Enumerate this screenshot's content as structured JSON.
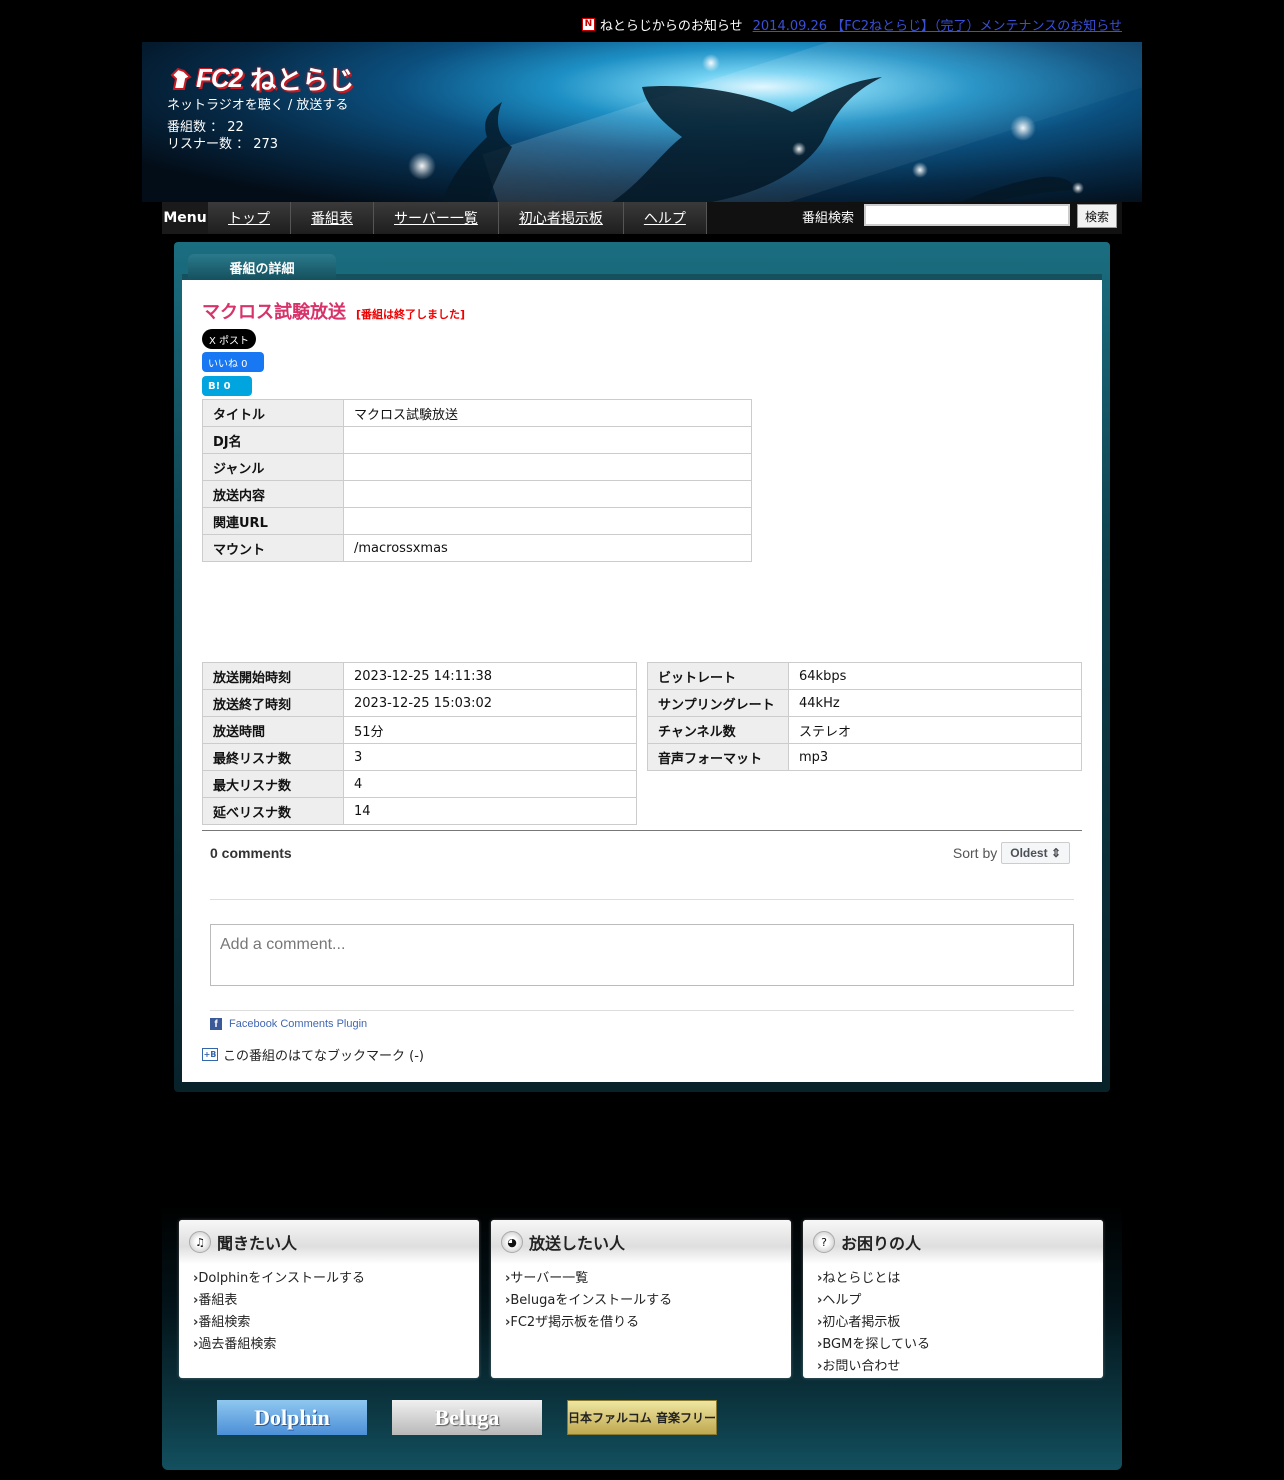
{
  "notice": {
    "icon": "fc2-notice-icon",
    "label": "ねとらじからのお知らせ",
    "link_text": "2014.09.26 【FC2ねとらじ】（完了）メンテナンスのお知らせ"
  },
  "header": {
    "logo_fc2": "FC2",
    "logo_name": "ねとらじ",
    "tagline": "ネットラジオを聴く / 放送する",
    "program_count": "番組数 ： 22",
    "listener_count": "リスナー数 ： 273"
  },
  "nav": {
    "menu_label": "Menu",
    "items": [
      {
        "label": "トップ"
      },
      {
        "label": "番組表"
      },
      {
        "label": "サーバー一覧"
      },
      {
        "label": "初心者掲示板"
      },
      {
        "label": "ヘルプ"
      }
    ],
    "search_label": "番組検索",
    "search_value": "",
    "search_button": "検索"
  },
  "detail": {
    "tab_label": "番組の詳細",
    "title": "マクロス試験放送",
    "ended_badge": "[番組は終了しました]",
    "share": {
      "x_label": "X ポスト",
      "fb_label": "いいね 0",
      "hatena_label": "B! 0"
    },
    "info": [
      {
        "key": "タイトル",
        "value": "マクロス試験放送"
      },
      {
        "key": "DJ名",
        "value": ""
      },
      {
        "key": "ジャンル",
        "value": ""
      },
      {
        "key": "放送内容",
        "value": ""
      },
      {
        "key": "関連URL",
        "value": ""
      },
      {
        "key": "マウント",
        "value": "/macrossxmas"
      }
    ],
    "timing": [
      {
        "key": "放送開始時刻",
        "value": "2023-12-25 14:11:38"
      },
      {
        "key": "放送終了時刻",
        "value": "2023-12-25 15:03:02"
      },
      {
        "key": "放送時間",
        "value": "51分"
      },
      {
        "key": "最終リスナ数",
        "value": "3"
      },
      {
        "key": "最大リスナ数",
        "value": "4"
      },
      {
        "key": "延べリスナ数",
        "value": "14"
      }
    ],
    "audio": [
      {
        "key": "ビットレート",
        "value": "64kbps"
      },
      {
        "key": "サンプリングレート",
        "value": "44kHz"
      },
      {
        "key": "チャンネル数",
        "value": "ステレオ"
      },
      {
        "key": "音声フォーマット",
        "value": "mp3"
      }
    ]
  },
  "comments": {
    "count_label": "0 comments",
    "sort_label": "Sort by",
    "sort_value": "Oldest",
    "placeholder": "Add a comment...",
    "plugin_label": "Facebook Comments Plugin",
    "hatena_bookmark": "この番組のはてなブックマーク (-)"
  },
  "footer": {
    "boxes": [
      {
        "title": "聞きたい人",
        "icon": "music-note-icon",
        "items": [
          "Dolphinをインストールする",
          "番組表",
          "番組検索",
          "過去番組検索"
        ]
      },
      {
        "title": "放送したい人",
        "icon": "broadcast-icon",
        "items": [
          "サーバー一覧",
          "Belugaをインストールする",
          "FC2ザ掲示板を借りる"
        ]
      },
      {
        "title": "お困りの人",
        "icon": "help-icon",
        "items": [
          "ねとらじとは",
          "ヘルプ",
          "初心者掲示板",
          "BGMを探している",
          "お問い合わせ"
        ]
      }
    ],
    "banners": [
      "Dolphin",
      "Beluga",
      "日本ファルコム 音楽フリー"
    ]
  }
}
